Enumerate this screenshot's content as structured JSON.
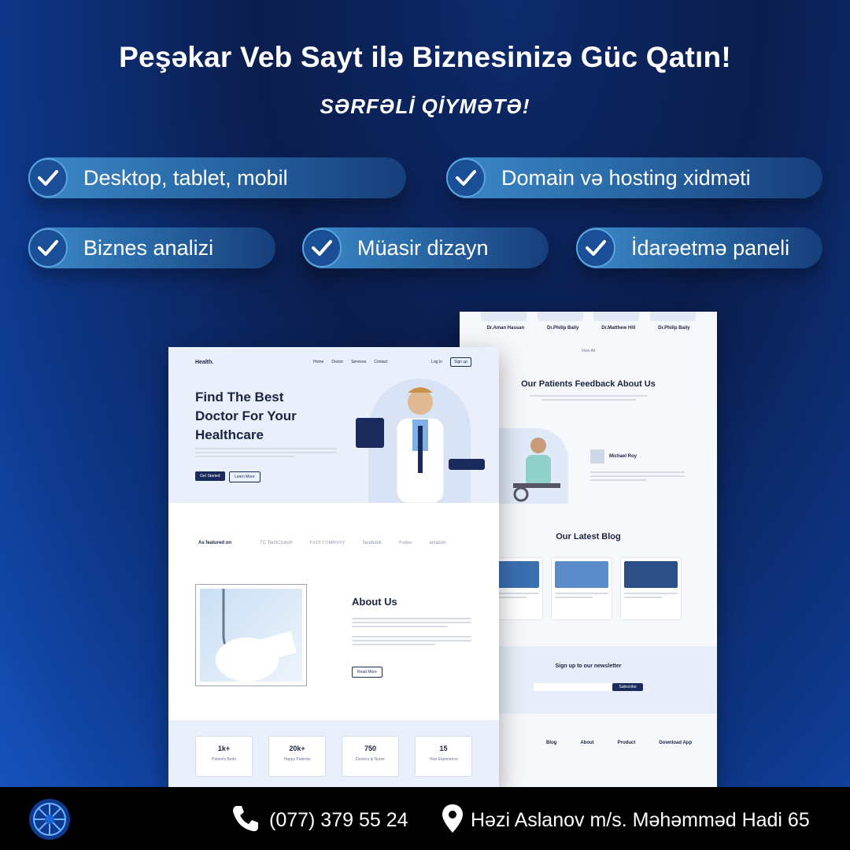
{
  "headline": "Peşəkar Veb Sayt ilə Biznesinizə Güc Qatın!",
  "subline": "SƏRFƏLİ QİYMƏTƏ!",
  "features": [
    "Desktop, tablet, mobil",
    "Domain və hosting xidməti",
    "Biznes analizi",
    "Müasir dizayn",
    "İdarəetmə paneli"
  ],
  "mock_front": {
    "logo": "Health.",
    "nav": [
      "Home",
      "Doctor",
      "Services",
      "Contact"
    ],
    "login": "Log In",
    "signup": "Sign up",
    "hero_title_1": "Find The Best",
    "hero_title_2": "Doctor For Your",
    "hero_title_3": "Healthcare",
    "hero_cta_1": "Get Started",
    "hero_cta_2": "Learn More",
    "featured_label": "As featured on",
    "featured_logos": [
      "TC TechCrunch",
      "FAST COMPANY",
      "facebook",
      "Forbes",
      "amazon"
    ],
    "about_title": "About Us",
    "about_btn": "Read More",
    "stats": [
      {
        "value": "1k+",
        "label": "Patients Beds"
      },
      {
        "value": "20k+",
        "label": "Happy Patients"
      },
      {
        "value": "750",
        "label": "Doctors & Nurse"
      },
      {
        "value": "15",
        "label": "Year Experience"
      }
    ]
  },
  "mock_back": {
    "doctors": [
      "Dr.Aman Hassan",
      "Dr.Philip Baily",
      "Dr.Matthew Hill",
      "Dr.Philip Baily"
    ],
    "view_all": "View All",
    "feedback_title": "Our Patients Feedback About Us",
    "reviewer": "Michael Roy",
    "blog_title": "Our Latest Blog",
    "newsletter_title": "Sign up to our newsletter",
    "newsletter_btn": "Subscribe",
    "footer_cols": [
      "Blog",
      "About",
      "Product",
      "Download App"
    ]
  },
  "contact": {
    "phone": "(077) 379 55 24",
    "address": "Həzi Aslanov m/s. Məhəmməd Hadi 65"
  }
}
